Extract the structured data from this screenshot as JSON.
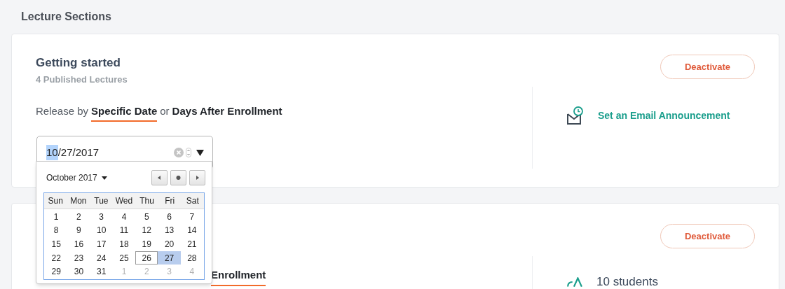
{
  "page_title": "Lecture Sections",
  "sections": [
    {
      "title": "Getting started",
      "subtitle": "4 Published Lectures",
      "release_prefix": "Release by",
      "release_joiner": "or",
      "release_options": [
        {
          "label": "Specific Date",
          "selected": true
        },
        {
          "label": "Days After Enrollment",
          "selected": false
        }
      ],
      "date_field": {
        "separator": "/",
        "segments": [
          {
            "text": "10",
            "selected": true
          },
          {
            "text": "27",
            "selected": false
          },
          {
            "text": "2017",
            "selected": false
          }
        ]
      },
      "action_button": "Deactivate",
      "side_link": {
        "kind": "email",
        "label": "Set an Email Announcement"
      }
    },
    {
      "release_options": [
        {
          "label": "Enrollment",
          "selected": true
        }
      ],
      "action_button": "Deactivate",
      "side_link": {
        "kind": "students",
        "label": "10 students"
      }
    }
  ],
  "date_picker": {
    "month_label": "October 2017",
    "weekdays": [
      "Sun",
      "Mon",
      "Tue",
      "Wed",
      "Thu",
      "Fri",
      "Sat"
    ],
    "days": [
      {
        "label": "1",
        "in_month": true,
        "today": false,
        "selected": false
      },
      {
        "label": "2",
        "in_month": true,
        "today": false,
        "selected": false
      },
      {
        "label": "3",
        "in_month": true,
        "today": false,
        "selected": false
      },
      {
        "label": "4",
        "in_month": true,
        "today": false,
        "selected": false
      },
      {
        "label": "5",
        "in_month": true,
        "today": false,
        "selected": false
      },
      {
        "label": "6",
        "in_month": true,
        "today": false,
        "selected": false
      },
      {
        "label": "7",
        "in_month": true,
        "today": false,
        "selected": false
      },
      {
        "label": "8",
        "in_month": true,
        "today": false,
        "selected": false
      },
      {
        "label": "9",
        "in_month": true,
        "today": false,
        "selected": false
      },
      {
        "label": "10",
        "in_month": true,
        "today": false,
        "selected": false
      },
      {
        "label": "11",
        "in_month": true,
        "today": false,
        "selected": false
      },
      {
        "label": "12",
        "in_month": true,
        "today": false,
        "selected": false
      },
      {
        "label": "13",
        "in_month": true,
        "today": false,
        "selected": false
      },
      {
        "label": "14",
        "in_month": true,
        "today": false,
        "selected": false
      },
      {
        "label": "15",
        "in_month": true,
        "today": false,
        "selected": false
      },
      {
        "label": "16",
        "in_month": true,
        "today": false,
        "selected": false
      },
      {
        "label": "17",
        "in_month": true,
        "today": false,
        "selected": false
      },
      {
        "label": "18",
        "in_month": true,
        "today": false,
        "selected": false
      },
      {
        "label": "19",
        "in_month": true,
        "today": false,
        "selected": false
      },
      {
        "label": "20",
        "in_month": true,
        "today": false,
        "selected": false
      },
      {
        "label": "21",
        "in_month": true,
        "today": false,
        "selected": false
      },
      {
        "label": "22",
        "in_month": true,
        "today": false,
        "selected": false
      },
      {
        "label": "23",
        "in_month": true,
        "today": false,
        "selected": false
      },
      {
        "label": "24",
        "in_month": true,
        "today": false,
        "selected": false
      },
      {
        "label": "25",
        "in_month": true,
        "today": false,
        "selected": false
      },
      {
        "label": "26",
        "in_month": true,
        "today": true,
        "selected": false
      },
      {
        "label": "27",
        "in_month": true,
        "today": false,
        "selected": true
      },
      {
        "label": "28",
        "in_month": true,
        "today": false,
        "selected": false
      },
      {
        "label": "29",
        "in_month": true,
        "today": false,
        "selected": false
      },
      {
        "label": "30",
        "in_month": true,
        "today": false,
        "selected": false
      },
      {
        "label": "31",
        "in_month": true,
        "today": false,
        "selected": false
      },
      {
        "label": "1",
        "in_month": false,
        "today": false,
        "selected": false
      },
      {
        "label": "2",
        "in_month": false,
        "today": false,
        "selected": false
      },
      {
        "label": "3",
        "in_month": false,
        "today": false,
        "selected": false
      },
      {
        "label": "4",
        "in_month": false,
        "today": false,
        "selected": false
      }
    ]
  }
}
